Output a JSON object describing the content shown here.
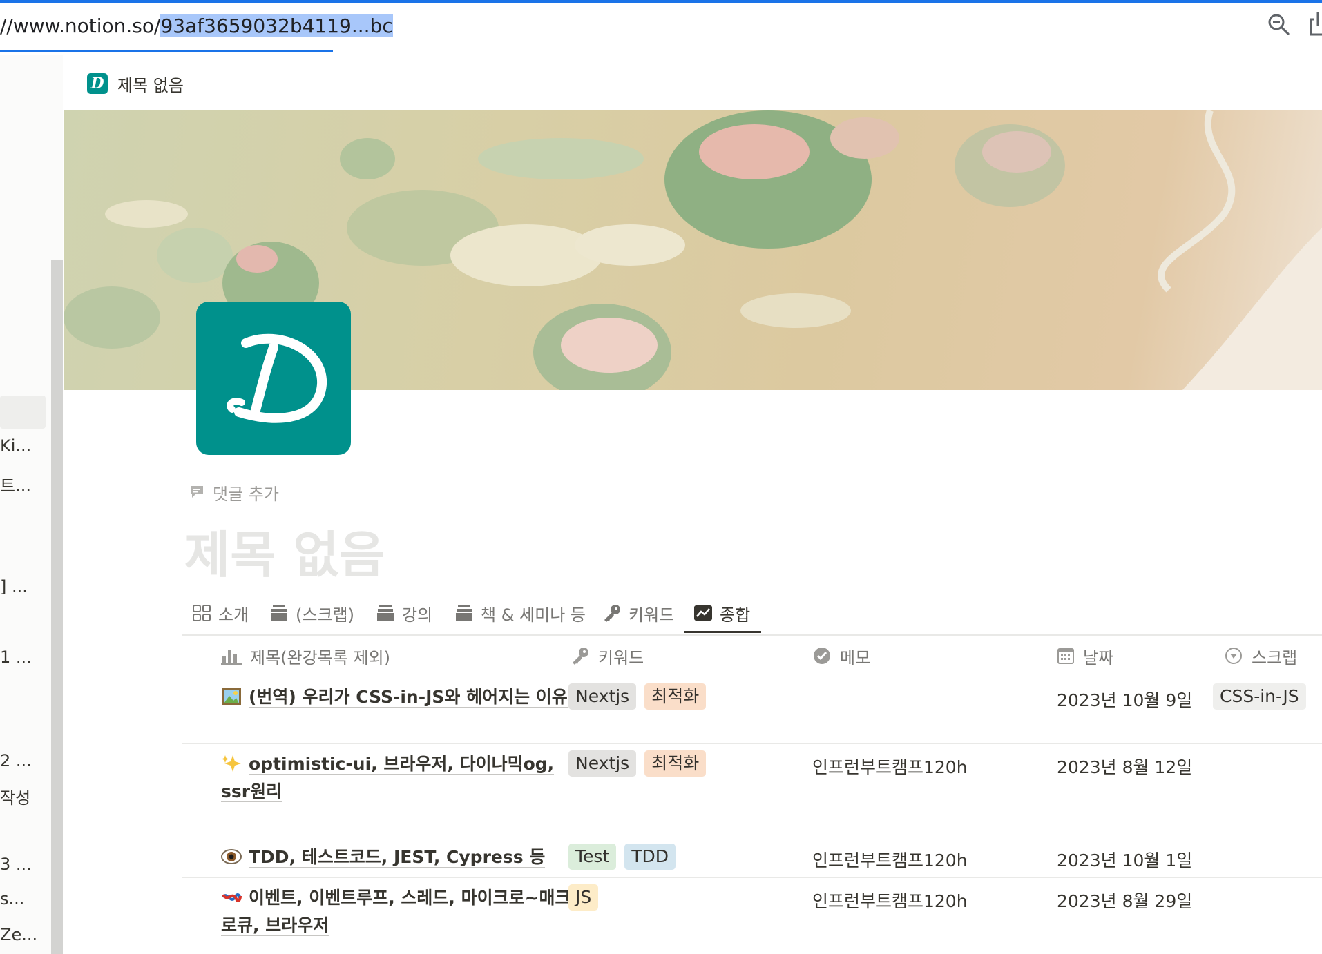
{
  "browser": {
    "url_prefix": "//www.notion.so/",
    "url_selected": "93af3659032b411",
    "url_rest": "9...bc"
  },
  "sidebar": {
    "items": [
      "Ki...",
      "트...",
      "] ...",
      "1 ...",
      "2 ...",
      "작성",
      "3 ...",
      "s...",
      "Ze..."
    ]
  },
  "topbar": {
    "icon_letter": "D",
    "title": "제목 없음"
  },
  "page": {
    "add_comment": "댓글 추가",
    "title": "제목 없음"
  },
  "tabs": [
    {
      "label": "소개",
      "icon": "gallery-icon"
    },
    {
      "label": "(스크랩)",
      "icon": "stack-icon"
    },
    {
      "label": "강의",
      "icon": "stack-icon"
    },
    {
      "label": "책 & 세미나 등",
      "icon": "stack-icon"
    },
    {
      "label": "키워드",
      "icon": "key-icon"
    },
    {
      "label": "종합",
      "icon": "chart-icon",
      "active": true
    }
  ],
  "table": {
    "columns": [
      {
        "label": "제목(완강목록 제외)",
        "icon": "bar-chart-icon"
      },
      {
        "label": "키워드",
        "icon": "key-icon"
      },
      {
        "label": "메모",
        "icon": "check-circle-icon"
      },
      {
        "label": "날짜",
        "icon": "calendar-icon"
      },
      {
        "label": "스크랩",
        "icon": "select-icon"
      }
    ],
    "rows": [
      {
        "emoji": "picture-icon",
        "title": "(번역) 우리가 CSS-in-JS와 헤어지는 이유",
        "tags": [
          {
            "label": "Nextjs",
            "color": "#e3e2e0"
          },
          {
            "label": "최적화",
            "color": "#fadec9"
          }
        ],
        "memo": "",
        "date": "2023년 10월 9일",
        "scrap": "CSS-in-JS"
      },
      {
        "emoji": "sparkles-icon",
        "title": "optimistic-ui, 브라우저, 다이나믹og, ssr원리",
        "tags": [
          {
            "label": "Nextjs",
            "color": "#e3e2e0"
          },
          {
            "label": "최적화",
            "color": "#fadec9"
          }
        ],
        "memo": "인프런부트캠프120h",
        "date": "2023년 8월 12일",
        "scrap": ""
      },
      {
        "emoji": "eye-icon",
        "title": "TDD, 테스트코드, JEST, Cypress 등",
        "tags": [
          {
            "label": "Test",
            "color": "#dbeddb"
          },
          {
            "label": "TDD",
            "color": "#d3e5ef"
          }
        ],
        "memo": "인프런부트캠프120h",
        "date": "2023년 10월 1일",
        "scrap": ""
      },
      {
        "emoji": "knot-icon",
        "title": "이벤트, 이벤트루프, 스레드, 마이크로~매크로큐, 브라우저",
        "tags": [
          {
            "label": "JS",
            "color": "#fdecc8"
          }
        ],
        "memo": "인프런부트캠프120h",
        "date": "2023년 8월 29일",
        "scrap": ""
      }
    ]
  }
}
